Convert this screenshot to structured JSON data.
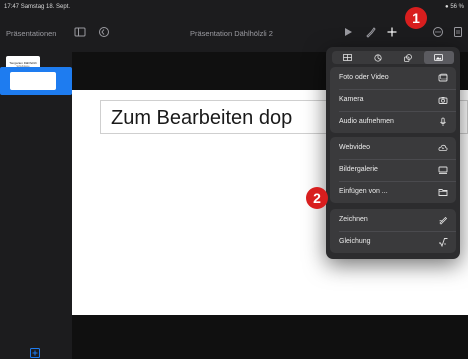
{
  "status_bar": {
    "time": "17:47",
    "date": "Samstag 18. Sept.",
    "battery": "56 %"
  },
  "toolbar": {
    "back_label": "Präsentationen",
    "document_title": "Präsentation Dählhölzli 2"
  },
  "sidebar": {
    "slides": [
      {
        "title": "Tiergarten Dählhölzli",
        "subtitle": "Schulklasse"
      }
    ]
  },
  "slide": {
    "title_placeholder": "Zum Bearbeiten dop"
  },
  "insert_menu": {
    "tabs": [
      {
        "icon": "table-icon"
      },
      {
        "icon": "chart-icon"
      },
      {
        "icon": "shapes-icon"
      },
      {
        "icon": "media-icon",
        "selected": true
      }
    ],
    "groups": [
      [
        {
          "label": "Foto oder Video",
          "icon": "photo-icon"
        },
        {
          "label": "Kamera",
          "icon": "camera-icon"
        },
        {
          "label": "Audio aufnehmen",
          "icon": "microphone-icon"
        }
      ],
      [
        {
          "label": "Webvideo",
          "icon": "cloud-play-icon"
        },
        {
          "label": "Bildergalerie",
          "icon": "gallery-icon"
        },
        {
          "label": "Einfügen von ...",
          "icon": "folder-icon"
        }
      ],
      [
        {
          "label": "Zeichnen",
          "icon": "pencil-icon"
        },
        {
          "label": "Gleichung",
          "icon": "equation-icon"
        }
      ]
    ]
  },
  "badges": {
    "one": "1",
    "two": "2"
  },
  "colors": {
    "badge": "#d81e1e",
    "selection": "#1e7cf0",
    "popover": "#2c2c2e"
  }
}
